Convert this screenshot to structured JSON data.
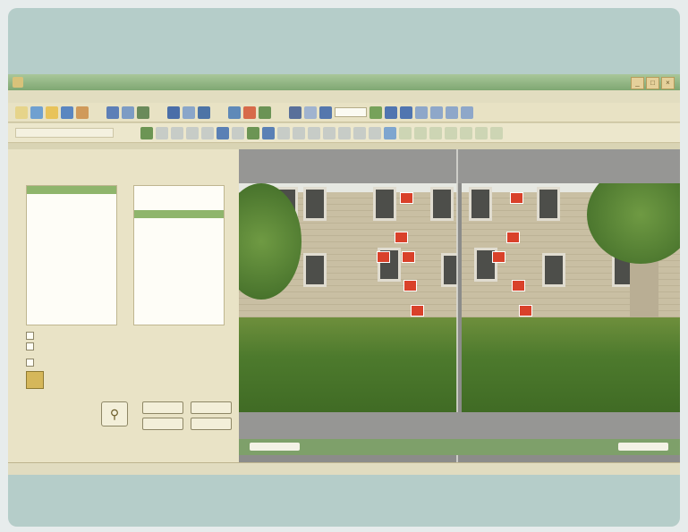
{
  "window": {
    "title": "",
    "controls": [
      "_",
      "□",
      "×"
    ]
  },
  "menu": {
    "items": [
      "",
      "",
      "",
      "",
      "",
      "",
      "",
      ""
    ]
  },
  "panel": {
    "title": "",
    "left_list": {
      "header": "",
      "rows": [
        "",
        "",
        "",
        "",
        "",
        "",
        "",
        "",
        ""
      ],
      "selected_index": 0
    },
    "right_list": {
      "header": "",
      "rows": [
        "",
        "",
        "",
        "",
        ""
      ],
      "selected_index": 3
    },
    "checkboxes": [
      "",
      "",
      ""
    ],
    "note": "",
    "buttons": {
      "b1": "",
      "b2": "",
      "b3": "",
      "b4": ""
    }
  },
  "viewer": {
    "markers_left": [
      "",
      "",
      "",
      "",
      "",
      ""
    ],
    "markers_right": [
      "",
      "",
      "",
      "",
      "",
      ""
    ]
  },
  "colors": {
    "titlebar": "#7fa772",
    "window_bg": "#d9d4b4",
    "card_bg": "#b5cdc9",
    "marker": "#d9412a",
    "selection": "#8fb56c"
  },
  "icons": {
    "search_button": "magnifier-icon"
  }
}
